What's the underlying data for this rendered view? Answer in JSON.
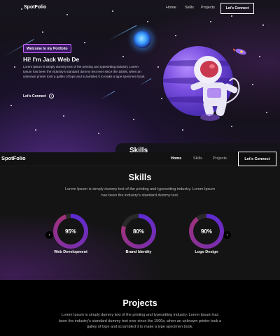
{
  "hero": {
    "logo": "SpotFolio",
    "nav": [
      "Home",
      "Skills",
      "Projects"
    ],
    "cta_button": "Let's Connect",
    "badge": "Welcome to my Portfolio",
    "title": "Hi! I'm Jack Web De",
    "text": "Lorem Ipsum is simply dummy text of the printing and typesetting industry. Lorem Ipsum has been the industry's standard dummy text ever since the 1500s, when an unknown printer took a galley of type and scrambled it to make a type specimen book.",
    "link": "Let's Connect",
    "link_icon": "arrow-circle-icon",
    "peek_title": "Skills"
  },
  "nav": {
    "logo": "SpotFolio",
    "links": [
      "Home",
      "Skills",
      "Projects"
    ],
    "button": "Let's Connect"
  },
  "skills": {
    "title": "Skills",
    "text": "Lorem Ipsum is simply dummy text of the printing and typesetting industry. Lorem Ipsum has been the industry's standard dummy text.",
    "items": [
      {
        "label": "Web Development",
        "value": "95%",
        "percent": 95
      },
      {
        "label": "Brand Identity",
        "value": "80%",
        "percent": 80
      },
      {
        "label": "Logo Design",
        "value": "90%",
        "percent": 90
      }
    ],
    "prev_icon": "chevron-left-icon",
    "next_icon": "chevron-right-icon"
  },
  "projects": {
    "title": "Projects",
    "text": "Lorem Ipsum is simply dummy text of the printing and typesetting industry. Lorem Ipsum has been the industry's standard dummy text ever since the 1500s, when an unknown printer took a galley of type and scrambled it to make a type specimen book."
  },
  "colors": {
    "accent": "#7a4fe0",
    "ring_start": "#a0327a",
    "ring_end": "#5b2bd6",
    "badge_bg": "#3a1763"
  }
}
